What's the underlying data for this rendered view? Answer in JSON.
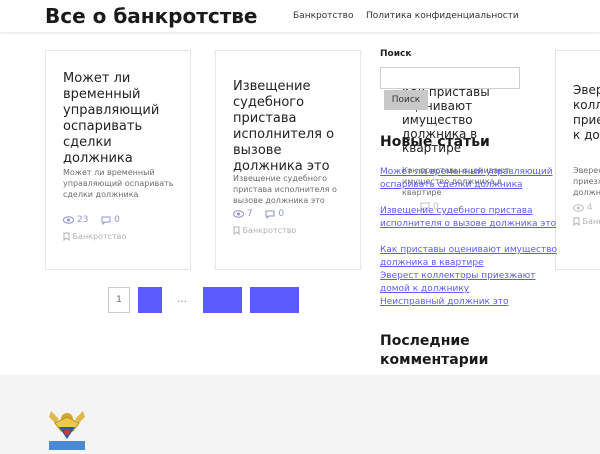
{
  "header": {
    "site_title": "Все о банкротстве",
    "nav": [
      "Банкротство",
      "Политика конфиденциальности"
    ]
  },
  "posts": [
    {
      "title": "Может ли временный управляющий оспаривать сделки должника",
      "excerpt": "Может ли временный управляющий оспаривать сделки должника",
      "views": "23",
      "comments": "0",
      "category": "Банкротство"
    },
    {
      "title": "Извещение судебного пристава исполнителя о вызове должника это",
      "excerpt": "Извещение судебного пристава исполнителя о вызове должника это",
      "views": "7",
      "comments": "0",
      "category": "Банкротство"
    },
    {
      "title": "Как приставы оценивают имущество должника в квартире",
      "excerpt": "Как приставы оценивают имущество должника в квартире",
      "views": "",
      "comments": "0",
      "category": "Банкротство"
    },
    {
      "title": "Эверест коллекторы приезжают домой к должнику",
      "excerpt": "Эверест коллекторы приезжают домой к должнику",
      "views": "4",
      "comments": "",
      "category": "Банкротство"
    }
  ],
  "pagination": {
    "current": "1",
    "dots": "…"
  },
  "sidebar": {
    "search_label": "Поиск",
    "search_button": "Поиск",
    "new_posts_heading": "Новые статьи",
    "new_posts": [
      "Может ли временный управляющий оспаривать сделки должника",
      "Извещение судебного пристава исполнителя о вызове должника это",
      "Как приставы оценивают имущество должника в квартире",
      "Эверест коллекторы приезжают домой к должнику",
      "Неисправный должник это"
    ],
    "comments_heading": "Последние комментарии"
  },
  "colors": {
    "accent": "#5b5bff",
    "meta": "#8f93c9",
    "muted": "#b1b1b1"
  }
}
